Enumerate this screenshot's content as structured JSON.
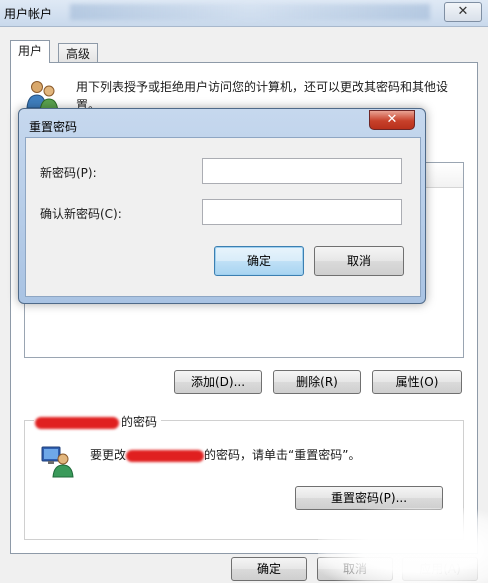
{
  "window": {
    "title": "用户帐户",
    "close_glyph": "✕"
  },
  "tabs": [
    {
      "label": "用户"
    },
    {
      "label": "高级"
    }
  ],
  "intro": {
    "text": "用下列表授予或拒绝用户访问您的计算机，还可以更改其密码和其他设置。"
  },
  "buttons": {
    "add": "添加(D)...",
    "delete": "删除(R)",
    "properties": "属性(O)"
  },
  "password_group": {
    "title_suffix": "的密码",
    "instruction_prefix": "要更改",
    "instruction_suffix": "的密码，请单击“重置密码”。",
    "reset_button": "重置密码(P)..."
  },
  "footer": {
    "ok": "确定",
    "cancel": "取消",
    "apply": "应用(A)"
  },
  "dialog": {
    "title": "重置密码",
    "close_glyph": "✕",
    "new_password_label": "新密码(P):",
    "new_password_value": "",
    "confirm_password_label": "确认新密码(C):",
    "confirm_password_value": "",
    "ok": "确定",
    "cancel": "取消"
  },
  "icons": {
    "users": "users-icon",
    "user_with_monitor": "user-monitor-icon",
    "close": "close-icon"
  },
  "colors": {
    "dialog_frame": "#a9c3e3",
    "close_button": "#c7402a",
    "default_button_border": "#3c7fb1",
    "redaction": "#e02020"
  }
}
